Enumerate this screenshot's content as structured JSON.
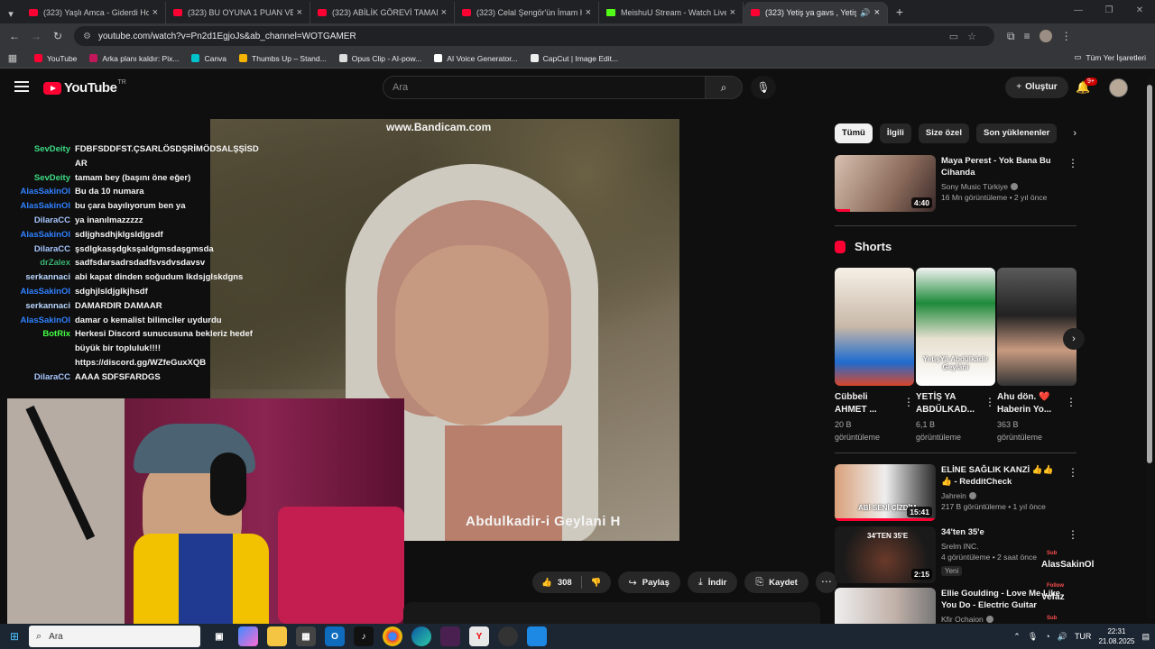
{
  "browser": {
    "tabs": [
      {
        "title": "(323) Yaşlı Amca - Giderdi Hoşuma",
        "type": "yt"
      },
      {
        "title": "(323) BU OYUNA 1 PUAN VERİN",
        "type": "yt"
      },
      {
        "title": "(323) ABİLİK GÖREVİ TAMAMLA",
        "type": "yt"
      },
      {
        "title": "(323) Celal Şengör'ün İmam Ha",
        "type": "yt"
      },
      {
        "title": "MeishuU Stream - Watch Live o",
        "type": "kick"
      },
      {
        "title": "(323) Yetiş ya gavs , Yetiş ya",
        "type": "yt",
        "active": true
      }
    ],
    "url": "youtube.com/watch?v=Pn2d1EgjoJs&ab_channel=WOTGAMER",
    "bookmarks": [
      {
        "label": "YouTube",
        "color": "#ff0033"
      },
      {
        "label": "Arka planı kaldır: Pix...",
        "color": "#c2185b"
      },
      {
        "label": "Canva",
        "color": "#00c4cc"
      },
      {
        "label": "Thumbs Up – Stand...",
        "color": "#f5b400"
      },
      {
        "label": "Opus Clip - AI-pow...",
        "color": "#dddddd"
      },
      {
        "label": "AI Voice Generator...",
        "color": "#ffffff"
      },
      {
        "label": "CapCut | Image Edit...",
        "color": "#eeeeee"
      }
    ],
    "bookmarks_right": "Tüm Yer İşaretleri"
  },
  "youtube": {
    "logo_text": "YouTube",
    "region": "TR",
    "search_placeholder": "Ara",
    "create_label": "Oluştur",
    "notif_count": "9+"
  },
  "player": {
    "watermark": "www.Bandicam.com",
    "subtitle": "Abdulkadir-i Geylani H",
    "chat": [
      {
        "user": "SevDeity",
        "msg": "FDBFSDDFST.ÇSARLÖSDŞRİMÖDSALŞŞİSD AR",
        "cls": "sd"
      },
      {
        "user": "SevDeity",
        "msg": "tamam bey (başını öne eğer)",
        "cls": "sd"
      },
      {
        "user": "AlasSakinOl",
        "msg": "Bu da 10 numara",
        "cls": "al"
      },
      {
        "user": "AlasSakinOl",
        "msg": "bu çara bayılıyorum ben ya",
        "cls": "al"
      },
      {
        "user": "DilaraCC",
        "msg": "ya inanılmazzzzz",
        "cls": "dc"
      },
      {
        "user": "AlasSakinOl",
        "msg": "sdljghsdhjklgsldjgsdf",
        "cls": "al"
      },
      {
        "user": "DilaraCC",
        "msg": "şsdlgkasşdgksşaldgmsdaşgmsda",
        "cls": "dc"
      },
      {
        "user": "drZalex",
        "msg": "sadfsdarsadrsdadfsvsdvsdavsv",
        "cls": "dz"
      },
      {
        "user": "serkannaci",
        "msg": "abi kapat dinden soğudum lkdsjglskdgns",
        "cls": "sk"
      },
      {
        "user": "AlasSakinOl",
        "msg": "sdghjlsldjglkjhsdf",
        "cls": "al"
      },
      {
        "user": "serkannaci",
        "msg": "DAMARDIR DAMAAR",
        "cls": "sk"
      },
      {
        "user": "AlasSakinOl",
        "msg": "damar o kemalist bilimciler uydurdu",
        "cls": "al"
      },
      {
        "user": "BotRix",
        "msg": "Herkesi Discord sunucusuna bekleriz hedef büyük bir topluluk!!!! https://discord.gg/WZfeGuxXQB",
        "cls": "br"
      },
      {
        "user": "DilaraCC",
        "msg": "AAAA SDFSFARDGS",
        "cls": "dc"
      }
    ]
  },
  "actions": {
    "like_count": "308",
    "share": "Paylaş",
    "download": "İndir",
    "save": "Kaydet"
  },
  "sidebar": {
    "chips": [
      "Tümü",
      "İlgili",
      "Size özel",
      "Son yüklenenler"
    ],
    "rec1": {
      "title": "Maya Perest - Yok Bana Bu Cihanda",
      "channel": "Sony Music Türkiye",
      "meta": "16 Mn görüntüleme • 2 yıl önce",
      "duration": "4:40",
      "progress": 0.15
    },
    "shorts_label": "Shorts",
    "shorts": [
      {
        "title": "Cübbeli AHMET ...",
        "views": "20 B görüntüleme",
        "caption": ""
      },
      {
        "title": "YETİŞ YA ABDÜLKAD...",
        "views": "6,1 B görüntüleme",
        "caption": "YetişYâ Abdülkâdir Geylânî"
      },
      {
        "title": "Ahu dön. ❤️ Haberin Yo...",
        "views": "363 B görüntüleme",
        "caption": ""
      }
    ],
    "rec2": {
      "title": "ELİNE SAĞLIK KANZİ 👍👍👍 - RedditCheck",
      "channel": "Jahrein",
      "meta": "217 B görüntüleme • 1 yıl önce",
      "duration": "15:41",
      "thumb_text": "ABİ SENİ ÇİZDİM",
      "progress": 1.0
    },
    "rec3": {
      "title": "34'ten 35'e",
      "channel": "Srelm INC.",
      "meta": "4 görüntüleme • 2 saat önce",
      "duration": "2:15",
      "badge": "Yeni",
      "thumb_text": "34'TEN 35'E"
    },
    "rec4": {
      "title": "Ellie Goulding - Love Me Like You Do - Electric Guitar Cover ...",
      "channel": "Kfir Ochaion"
    }
  },
  "overlay": {
    "names": [
      "AlasSakinOl",
      "Vefaz",
      "Fratika"
    ],
    "tags": [
      "Sub",
      "Follow",
      "Sub"
    ]
  },
  "taskbar": {
    "search": "Ara",
    "lang": "TUR",
    "time": "22:31",
    "date": "21.08.2025"
  }
}
